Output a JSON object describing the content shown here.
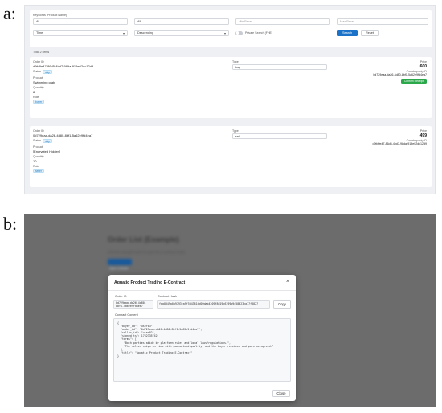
{
  "labels": {
    "a": "a:",
    "b": "b:"
  },
  "filters": {
    "keywords_label": "Keywords (Product Name)",
    "keywords_value": "All",
    "type_value": "All",
    "min_price_placeholder": "Min Price",
    "max_price_placeholder": "Max Price",
    "sort_field": "Time",
    "sort_order": "Descending",
    "private_label": "Private Search (FHE)",
    "search_btn": "Search",
    "reset_btn": "Reset"
  },
  "total": "Total 2 items",
  "orders": [
    {
      "order_id_label": "Order ID",
      "order_id": "d9fd9e47-86d5-4bd7-98da-919e02dc12d9",
      "status_label": "Status",
      "status": "ship",
      "product_label": "Product",
      "product": "Swimming crab",
      "quantity_label": "Quantity",
      "quantity": "8",
      "role_label": "Role",
      "role": "buyer",
      "type_label": "Type",
      "type": "buy",
      "price_label": "Price",
      "price": "600",
      "counterparty_label": "Counterparty ID",
      "counterparty": "0d729eaa-da26-4d80-8bf1-5a62e9fd4ea7",
      "action": "Confirm Receipt"
    },
    {
      "order_id_label": "Order ID",
      "order_id": "0d729eaa-da26-4d80-8bf1-5a62e9fd4ea7",
      "status_label": "Status",
      "status": "ship",
      "product_label": "Product",
      "product": "[Encrypted Hidden]",
      "quantity_label": "Quantity",
      "quantity": "10",
      "role_label": "Role",
      "role": "seller",
      "type_label": "Type",
      "type": "sell",
      "price_label": "Price",
      "price": "499",
      "counterparty_label": "Counterparty ID",
      "counterparty": "d9fd9e47-86d5-4bd7-98da-919e02dc12d9",
      "action": ""
    }
  ],
  "background": {
    "title": "Order List (Example)",
    "subtitle": "Click the example button to open the e-contract modal",
    "button": "Open Contract"
  },
  "modal": {
    "title": "Aquatic Product Trading E-Contract",
    "order_id_label": "Order ID",
    "order_id": "0d729eaa-da26-4d80-\n8bf1-5a62e9fd4ea7",
    "hash_label": "Contract Hash",
    "hash": "fea8049a0a9793ca9f5d4361dd09dab4209f8d19c6399b9c58923ca77f8827",
    "copy_btn": "Copy",
    "content_label": "Contract Content",
    "content": "{\n  \"buyer_id\": \"user03\",\n  \"order_id\": \"0d729eaa-da26-4d80-8bf1-5a62e9fd4ea7\",\n  \"seller_id\": \"user02\",\n  \"signed_ts\": 1762335742,\n  \"terms\": [\n    \"Both parties abide by platform rules and local laws/regulations.\",\n    \"The seller ships on time with guaranteed quality, and the buyer receives and pays as agreed.\"\n  ],\n  \"title\": \"Aquatic Product Trading E-Contract\"\n}",
    "close_btn": "Close"
  }
}
